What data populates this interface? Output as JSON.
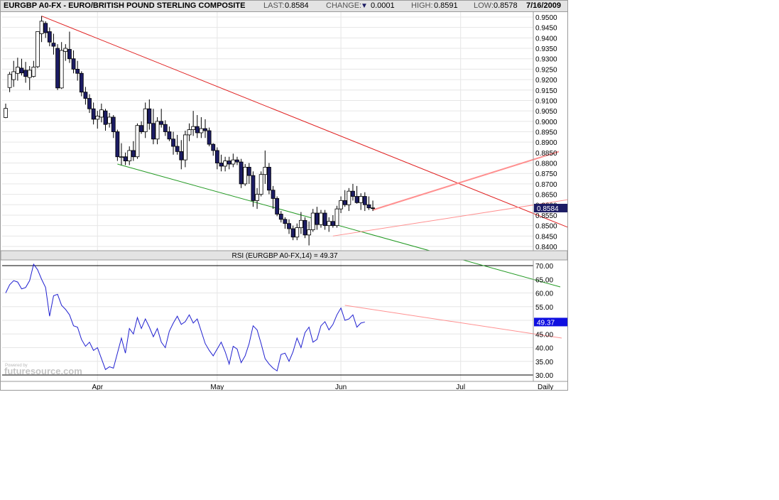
{
  "header": {
    "symbol": "EURGBP A0-FX - EURO/BRITISH POUND STERLING COMPOSITE",
    "last_label": "LAST:",
    "last_value": "0.8584",
    "change_label": "CHANGE:",
    "change_arrow": "▼",
    "change_value": "0.0001",
    "high_label": "HIGH:",
    "high_value": "0.8591",
    "low_label": "LOW:",
    "low_value": "0.8578",
    "date": "7/16/2009"
  },
  "colors": {
    "bull_candle": "#ffffff",
    "bear_candle": "#1c1c64",
    "trend_upper": "#e02020",
    "trend_lower": "#229922",
    "rsi_line": "#2020d0",
    "rsi_trend": "#ff9090",
    "last_badge": "#1c1c64",
    "rsi_badge": "#1010e0"
  },
  "chart_data": [
    {
      "type": "candlestick",
      "title": "EURGBP A0-FX - EURO/BRITISH POUND STERLING COMPOSITE",
      "ylim": [
        0.8375,
        0.9525
      ],
      "grid": true,
      "y_ticks": [
        "0.9500",
        "0.9450",
        "0.9400",
        "0.9350",
        "0.9300",
        "0.9250",
        "0.9200",
        "0.9150",
        "0.9100",
        "0.9050",
        "0.9000",
        "0.8950",
        "0.8900",
        "0.8850",
        "0.8800",
        "0.8750",
        "0.8700",
        "0.8650",
        "0.8600",
        "0.8550",
        "0.8500",
        "0.8450",
        "0.8400"
      ],
      "y_tick_values": [
        0.95,
        0.945,
        0.94,
        0.935,
        0.93,
        0.925,
        0.92,
        0.915,
        0.91,
        0.905,
        0.9,
        0.895,
        0.89,
        0.885,
        0.88,
        0.875,
        0.87,
        0.865,
        0.86,
        0.855,
        0.85,
        0.845,
        0.84
      ],
      "x_ticks": [
        {
          "label": "Apr",
          "day": 23
        },
        {
          "label": "May",
          "day": 53
        },
        {
          "label": "Jun",
          "day": 84
        },
        {
          "label": "Jul",
          "day": 114
        }
      ],
      "last_label": "0.8584",
      "last_value": 0.8584,
      "candles": [
        [
          0,
          0.9018,
          0.9085,
          0.9015,
          0.9062
        ],
        [
          1,
          0.9162,
          0.9237,
          0.914,
          0.9225
        ],
        [
          2,
          0.92,
          0.929,
          0.9165,
          0.9238
        ],
        [
          3,
          0.923,
          0.9305,
          0.9195,
          0.926
        ],
        [
          4,
          0.9255,
          0.93,
          0.922,
          0.9232
        ],
        [
          5,
          0.9245,
          0.9285,
          0.9185,
          0.9215
        ],
        [
          6,
          0.921,
          0.9265,
          0.915,
          0.9245
        ],
        [
          7,
          0.9215,
          0.929,
          0.921,
          0.926
        ],
        [
          8,
          0.9262,
          0.9345,
          0.9255,
          0.943
        ],
        [
          9,
          0.942,
          0.9505,
          0.938,
          0.948
        ],
        [
          10,
          0.947,
          0.948,
          0.94,
          0.9425
        ],
        [
          11,
          0.943,
          0.945,
          0.936,
          0.938
        ],
        [
          12,
          0.9375,
          0.942,
          0.932,
          0.936
        ],
        [
          13,
          0.935,
          0.937,
          0.915,
          0.916
        ],
        [
          14,
          0.916,
          0.938,
          0.9155,
          0.934
        ],
        [
          15,
          0.9335,
          0.937,
          0.929,
          0.935
        ],
        [
          16,
          0.9345,
          0.943,
          0.928,
          0.93
        ],
        [
          17,
          0.93,
          0.934,
          0.923,
          0.925
        ],
        [
          18,
          0.925,
          0.929,
          0.9195,
          0.923
        ],
        [
          19,
          0.923,
          0.924,
          0.912,
          0.914
        ],
        [
          20,
          0.914,
          0.9165,
          0.908,
          0.911
        ],
        [
          21,
          0.911,
          0.913,
          0.904,
          0.906
        ],
        [
          22,
          0.906,
          0.909,
          0.8985,
          0.901
        ],
        [
          23,
          0.901,
          0.905,
          0.8965,
          0.9025
        ],
        [
          24,
          0.902,
          0.9085,
          0.8995,
          0.9055
        ],
        [
          25,
          0.905,
          0.906,
          0.8955,
          0.8985
        ],
        [
          26,
          0.899,
          0.904,
          0.897,
          0.902
        ],
        [
          27,
          0.902,
          0.903,
          0.892,
          0.895
        ],
        [
          28,
          0.895,
          0.896,
          0.881,
          0.883
        ],
        [
          29,
          0.883,
          0.8895,
          0.879,
          0.883
        ],
        [
          30,
          0.883,
          0.885,
          0.879,
          0.881
        ],
        [
          31,
          0.881,
          0.888,
          0.879,
          0.886
        ],
        [
          32,
          0.886,
          0.8905,
          0.881,
          0.883
        ],
        [
          33,
          0.883,
          0.899,
          0.882,
          0.898
        ],
        [
          34,
          0.898,
          0.9,
          0.894,
          0.895
        ],
        [
          35,
          0.895,
          0.909,
          0.892,
          0.906
        ],
        [
          36,
          0.906,
          0.9105,
          0.896,
          0.899
        ],
        [
          37,
          0.899,
          0.906,
          0.889,
          0.8915
        ],
        [
          38,
          0.8915,
          0.902,
          0.889,
          0.9
        ],
        [
          39,
          0.9,
          0.906,
          0.897,
          0.8985
        ],
        [
          40,
          0.8985,
          0.9005,
          0.893,
          0.895
        ],
        [
          41,
          0.895,
          0.8975,
          0.8905,
          0.8915
        ],
        [
          42,
          0.8915,
          0.895,
          0.884,
          0.888
        ],
        [
          43,
          0.888,
          0.8935,
          0.884,
          0.8855
        ],
        [
          44,
          0.8855,
          0.891,
          0.877,
          0.8815
        ],
        [
          45,
          0.8815,
          0.8955,
          0.878,
          0.8935
        ],
        [
          46,
          0.8935,
          0.899,
          0.8905,
          0.896
        ],
        [
          47,
          0.896,
          0.905,
          0.893,
          0.8975
        ],
        [
          48,
          0.8975,
          0.903,
          0.892,
          0.8945
        ],
        [
          49,
          0.8945,
          0.902,
          0.892,
          0.8965
        ],
        [
          50,
          0.8965,
          0.901,
          0.892,
          0.8955
        ],
        [
          51,
          0.8955,
          0.897,
          0.888,
          0.889
        ],
        [
          52,
          0.889,
          0.8895,
          0.8835,
          0.886
        ],
        [
          53,
          0.886,
          0.8875,
          0.877,
          0.88
        ],
        [
          54,
          0.88,
          0.884,
          0.876,
          0.8785
        ],
        [
          55,
          0.8785,
          0.883,
          0.876,
          0.881
        ],
        [
          56,
          0.881,
          0.883,
          0.877,
          0.8795
        ],
        [
          57,
          0.8795,
          0.8845,
          0.878,
          0.8815
        ],
        [
          58,
          0.8815,
          0.883,
          0.879,
          0.8805
        ],
        [
          59,
          0.8805,
          0.882,
          0.868,
          0.87
        ],
        [
          60,
          0.87,
          0.8795,
          0.869,
          0.878
        ],
        [
          61,
          0.878,
          0.88,
          0.87,
          0.874
        ],
        [
          62,
          0.874,
          0.876,
          0.859,
          0.862
        ],
        [
          63,
          0.862,
          0.868,
          0.858,
          0.865
        ],
        [
          64,
          0.865,
          0.876,
          0.864,
          0.8745
        ],
        [
          65,
          0.8745,
          0.886,
          0.87,
          0.878
        ],
        [
          66,
          0.878,
          0.88,
          0.865,
          0.867
        ],
        [
          67,
          0.867,
          0.869,
          0.858,
          0.863
        ],
        [
          68,
          0.863,
          0.864,
          0.8545,
          0.8555
        ],
        [
          69,
          0.8555,
          0.857,
          0.8515,
          0.853
        ],
        [
          70,
          0.853,
          0.854,
          0.8485,
          0.851
        ],
        [
          71,
          0.851,
          0.853,
          0.846,
          0.8485
        ],
        [
          72,
          0.8485,
          0.85,
          0.843,
          0.8445
        ],
        [
          73,
          0.8445,
          0.851,
          0.843,
          0.849
        ],
        [
          74,
          0.849,
          0.8565,
          0.846,
          0.8525
        ],
        [
          75,
          0.8525,
          0.854,
          0.844,
          0.8455
        ],
        [
          76,
          0.8455,
          0.852,
          0.8405,
          0.848
        ],
        [
          77,
          0.848,
          0.858,
          0.847,
          0.856
        ],
        [
          78,
          0.856,
          0.859,
          0.848,
          0.8505
        ],
        [
          79,
          0.8505,
          0.8575,
          0.849,
          0.856
        ],
        [
          80,
          0.856,
          0.8575,
          0.848,
          0.85
        ],
        [
          81,
          0.85,
          0.854,
          0.847,
          0.852
        ],
        [
          82,
          0.852,
          0.855,
          0.849,
          0.85
        ],
        [
          83,
          0.85,
          0.8595,
          0.849,
          0.858
        ],
        [
          84,
          0.858,
          0.864,
          0.856,
          0.862
        ],
        [
          85,
          0.862,
          0.867,
          0.859,
          0.86
        ],
        [
          86,
          0.86,
          0.868,
          0.857,
          0.8665
        ],
        [
          87,
          0.8665,
          0.87,
          0.862,
          0.864
        ],
        [
          88,
          0.864,
          0.869,
          0.8605,
          0.861
        ],
        [
          89,
          0.861,
          0.8655,
          0.8575,
          0.864
        ],
        [
          90,
          0.864,
          0.866,
          0.857,
          0.86
        ],
        [
          91,
          0.86,
          0.864,
          0.8575,
          0.8585
        ],
        [
          92,
          0.8585,
          0.862,
          0.857,
          0.8584
        ]
      ]
    },
    {
      "type": "line",
      "title": "RSI (EURGBP A0-FX,14) = 49.37",
      "ylim": [
        28,
        72
      ],
      "y_ticks": [
        "70.00",
        "65.00",
        "60.00",
        "55.00",
        "50.00",
        "45.00",
        "40.00",
        "35.00",
        "30.00"
      ],
      "y_tick_values": [
        70,
        65,
        60,
        55,
        50,
        45,
        40,
        35,
        30
      ],
      "reference_lines": [
        70,
        30
      ],
      "last_label": "49.37",
      "last_value": 49.37,
      "x_ticks": [
        {
          "label": "Apr",
          "day": 23
        },
        {
          "label": "May",
          "day": 53
        },
        {
          "label": "Jun",
          "day": 84
        },
        {
          "label": "Jul",
          "day": 114
        }
      ],
      "period_label": "Daily",
      "values": [
        60,
        63,
        64.5,
        64,
        61.5,
        62,
        64.5,
        70.5,
        68.5,
        65,
        62,
        51.5,
        59,
        59.5,
        55.5,
        54,
        52,
        48,
        47.5,
        43,
        40.5,
        42,
        39,
        40,
        36,
        32,
        33,
        32.5,
        38,
        43.5,
        38,
        47,
        45,
        51,
        47,
        50.5,
        47.5,
        44,
        47,
        42,
        40,
        46,
        49,
        51.5,
        48.5,
        49.5,
        52,
        49,
        50.5,
        46,
        41.5,
        39,
        37,
        39.5,
        42,
        38.5,
        34,
        40.5,
        39.5,
        34.5,
        37,
        41.5,
        48,
        46.5,
        41.5,
        36,
        34,
        32.5,
        31.5,
        37.5,
        38,
        35,
        38.5,
        43.5,
        40,
        45.5,
        47.5,
        42,
        43,
        48,
        49.5,
        46.5,
        48.5,
        52,
        54.5,
        50,
        50.5,
        52,
        47.5,
        49,
        49.37
      ]
    }
  ],
  "watermark": {
    "powered": "Powered by",
    "brand": "futuresource.com"
  }
}
